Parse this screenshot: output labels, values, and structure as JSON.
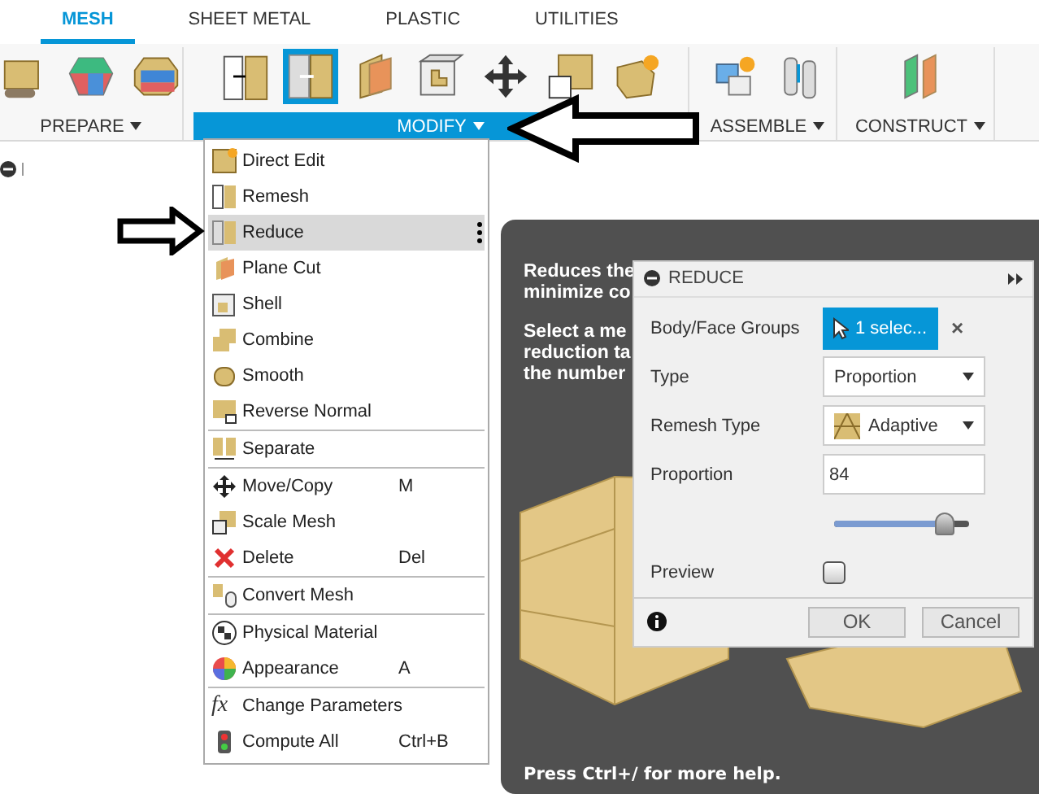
{
  "tabs": [
    {
      "label": "MESH",
      "selected": true
    },
    {
      "label": "SHEET METAL",
      "selected": false
    },
    {
      "label": "PLASTIC",
      "selected": false
    },
    {
      "label": "UTILITIES",
      "selected": false
    }
  ],
  "groups": [
    {
      "label": "PREPARE",
      "selected": false,
      "tools": [
        {
          "selected": false
        },
        {
          "selected": false
        },
        {
          "selected": false
        }
      ]
    },
    {
      "label": "MODIFY",
      "selected": true,
      "tools": [
        {
          "selected": false
        },
        {
          "selected": true
        },
        {
          "selected": false
        },
        {
          "selected": false
        },
        {
          "selected": false
        },
        {
          "selected": false
        },
        {
          "selected": false
        }
      ]
    },
    {
      "label": "ASSEMBLE",
      "selected": false,
      "tools": [
        {
          "selected": false
        },
        {
          "selected": false
        }
      ]
    },
    {
      "label": "CONSTRUCT",
      "selected": false,
      "tools": [
        {
          "selected": false
        }
      ]
    }
  ],
  "menu": {
    "sections": [
      [
        {
          "label": "Direct Edit",
          "selected": false
        },
        {
          "label": "Remesh",
          "selected": false
        },
        {
          "label": "Reduce",
          "selected": true
        },
        {
          "label": "Plane Cut",
          "selected": false
        },
        {
          "label": "Shell",
          "selected": false
        },
        {
          "label": "Combine",
          "selected": false
        },
        {
          "label": "Smooth",
          "selected": false
        },
        {
          "label": "Reverse Normal",
          "selected": false
        }
      ],
      [
        {
          "label": "Separate",
          "selected": false
        }
      ],
      [
        {
          "label": "Move/Copy",
          "shortcut": "M",
          "selected": false
        },
        {
          "label": "Scale Mesh",
          "selected": false
        },
        {
          "label": "Delete",
          "shortcut": "Del",
          "selected": false
        }
      ],
      [
        {
          "label": "Convert Mesh",
          "selected": false
        }
      ],
      [
        {
          "label": "Physical Material",
          "selected": false
        },
        {
          "label": "Appearance",
          "shortcut": "A",
          "selected": false
        }
      ],
      [
        {
          "label": "Change Parameters",
          "icon_text": "fx",
          "selected": false
        },
        {
          "label": "Compute All",
          "shortcut": "Ctrl+B",
          "selected": false
        }
      ]
    ]
  },
  "tooltip": {
    "paragraphs": [
      [
        "Reduces the",
        "minimize co"
      ],
      [
        "Select a me",
        "reduction ta",
        "the number"
      ]
    ],
    "footer": "Press Ctrl+/ for more help."
  },
  "dialog": {
    "title": "REDUCE",
    "rows": [
      {
        "kind": "selection",
        "label": "Body/Face Groups",
        "value": "1 selec...",
        "clear": "×"
      },
      {
        "kind": "dropdown",
        "label": "Type",
        "value": "Proportion"
      },
      {
        "kind": "dropdown_icon",
        "label": "Remesh Type",
        "value": "Adaptive"
      },
      {
        "kind": "input",
        "label": "Proportion",
        "value": "84"
      },
      {
        "kind": "slider",
        "level": 0.82
      },
      {
        "kind": "checkbox",
        "label": "Preview",
        "checked": false
      }
    ],
    "buttons": [
      "OK",
      "Cancel"
    ]
  }
}
